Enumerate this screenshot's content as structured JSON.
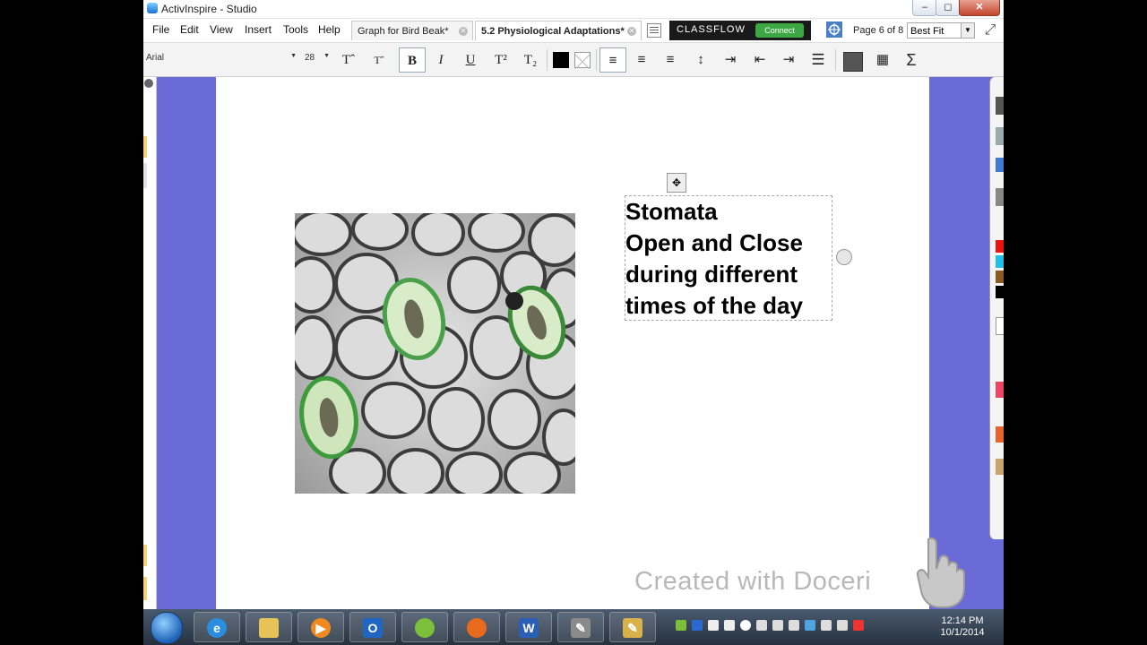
{
  "window": {
    "title": "ActivInspire - Studio"
  },
  "menu": [
    "File",
    "Edit",
    "View",
    "Insert",
    "Tools",
    "Help"
  ],
  "tabs": [
    {
      "label": "Graph for Bird Beak*",
      "active": false
    },
    {
      "label": "5.2 Physiological Adaptations*",
      "active": true
    }
  ],
  "classflow": {
    "logo": "CLASSFLOW",
    "connect": "Connect"
  },
  "page_nav": {
    "label": "Page 6 of 8",
    "zoom": "Best Fit"
  },
  "format_bar": {
    "font": "Arial",
    "size": "28",
    "buttons": [
      "increase-font",
      "decrease-font",
      "bold",
      "italic",
      "underline",
      "superscript",
      "subscript",
      "text-color",
      "highlight",
      "align-left",
      "align-center",
      "align-right",
      "line-spacing",
      "indent",
      "outdent",
      "indent-more",
      "bullets",
      "table",
      "select-all",
      "sigma"
    ]
  },
  "slide": {
    "text_lines": [
      "Stomata",
      "Open and Close",
      "during different",
      "times of the day"
    ]
  },
  "watermark": "Created with Doceri",
  "taskbar": {
    "clock_time": "12:14 PM",
    "clock_date": "10/1/2014"
  },
  "colors": {
    "workspace": "#6a6bd6",
    "classflow_connect": "#3da843"
  }
}
